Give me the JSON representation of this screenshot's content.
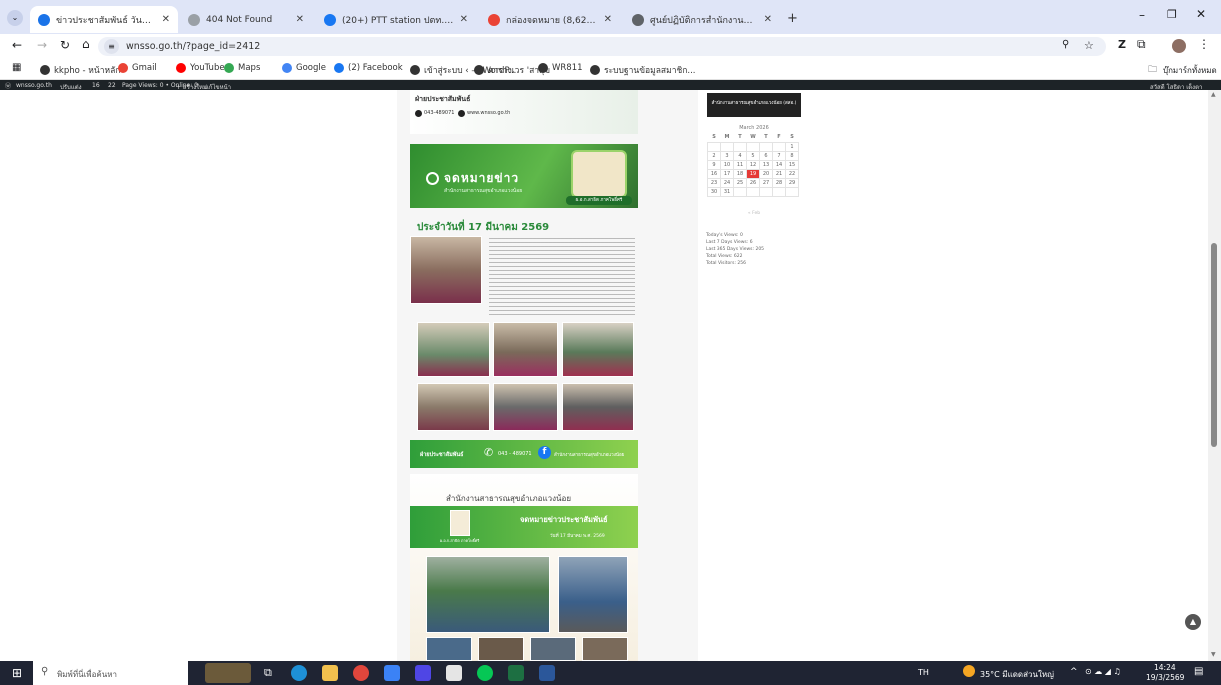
{
  "browser": {
    "tabs": [
      {
        "title": "ข่าวประชาสัมพันธ์ วันที่ 17 มีนาคม 2",
        "active": true,
        "color": "#1a73e8"
      },
      {
        "title": "404 Not Found",
        "active": false,
        "color": "#9aa0a6"
      },
      {
        "title": "(20+) PTT station ปตท. แวงน้อย",
        "active": false,
        "color": "#1877f2"
      },
      {
        "title": "กล่องจดหมาย (8,623) - sothidech",
        "active": false,
        "color": "#ea4335"
      },
      {
        "title": "ศูนย์ปฏิบัติการสำนักงานสาธารณสุข (สว",
        "active": false,
        "color": "#5f6368"
      }
    ],
    "new_tab": "+",
    "url": "wnsso.go.th/?page_id=2412",
    "bookmarks": [
      {
        "label": "kkpho - หน้าหลัก",
        "color": "#333"
      },
      {
        "label": "Gmail",
        "color": "#ea4335"
      },
      {
        "label": "YouTube",
        "color": "#ff0000"
      },
      {
        "label": "Maps",
        "color": "#34a853"
      },
      {
        "label": "Google",
        "color": "#4285f4"
      },
      {
        "label": "(2) Facebook",
        "color": "#1877f2"
      },
      {
        "label": "เข้าสู่ระบบ ‹ — WordP...",
        "color": "#333"
      },
      {
        "label": "ตารางเวร 'สาสุข",
        "color": "#333"
      },
      {
        "label": "WR811",
        "color": "#333"
      },
      {
        "label": "ระบบฐานข้อมูลสมาชิก...",
        "color": "#333"
      }
    ],
    "all_bookmarks": "บุ๊กมาร์กทั้งหมด"
  },
  "wp_admin": {
    "site": "wnsso.go.th",
    "items": [
      "ปรับแต่ง",
      "16",
      "22",
      "Page Views: 0 • Online: 0",
      "+ สร้างใหม่",
      "แก้ไขหน้า"
    ],
    "user": "สวัสดี โสธิดา เด็งตา"
  },
  "article": {
    "pr_label": "ฝ่ายประชาสัมพันธ์",
    "phone": "043-489071",
    "web": "www.wnsso.go.th",
    "banner_title": "จดหมายข่าว",
    "banner_sub": "สำนักงานสาธารณสุขอำเภอแวงน้อย",
    "person_caption": "ผ.อ.ก.สาธิต ภาคโพธิ์ศรี",
    "date_heading": "ประจำวันที่ 17 มีนาคม 2569",
    "footer_label": "ฝ่ายประชาสัมพันธ์",
    "footer_phone": "043 - 489071",
    "footer_fb": "สำนักงานสาธารณสุขอำเภอแวงน้อย",
    "second_title": "สำนักงานสาธารณสุขอำเภอแวงน้อย",
    "second_banner": "จดหมายข่าวประชาสัมพันธ์",
    "second_date": "วันที่ 17 มีนาคม พ.ศ. 2569",
    "second_person": "ผ.อ.ก.สาธิต ภาคโพธิ์ศรี"
  },
  "sidebar": {
    "box_title": "สำนักงานสาธารณสุขอำเภอแวงน้อย (สสอ.)",
    "calendar_month": "March 2026",
    "weekdays": [
      "S",
      "M",
      "T",
      "W",
      "T",
      "F",
      "S"
    ],
    "weeks": [
      [
        "",
        "",
        "",
        "",
        "",
        "",
        "1"
      ],
      [
        "2",
        "3",
        "4",
        "5",
        "6",
        "7",
        "8"
      ],
      [
        "9",
        "10",
        "11",
        "12",
        "13",
        "14",
        "15"
      ],
      [
        "16",
        "17",
        "18",
        "19",
        "20",
        "21",
        "22"
      ],
      [
        "23",
        "24",
        "25",
        "26",
        "27",
        "28",
        "29"
      ],
      [
        "30",
        "31",
        "",
        "",
        "",
        "",
        ""
      ]
    ],
    "today": "19",
    "nav_prev": "« Feb",
    "stats": [
      "Today's Views: 0",
      "Last 7 Days Views: 6",
      "Last 365 Days Views: 205",
      "Total Views: 622",
      "Total Visitors: 256"
    ]
  },
  "taskbar": {
    "search_placeholder": "พิมพ์ที่นี่เพื่อค้นหา",
    "lang": "TH",
    "weather": "35°C มีแดดส่วนใหญ่",
    "time": "14:24",
    "date": "19/3/2569"
  }
}
